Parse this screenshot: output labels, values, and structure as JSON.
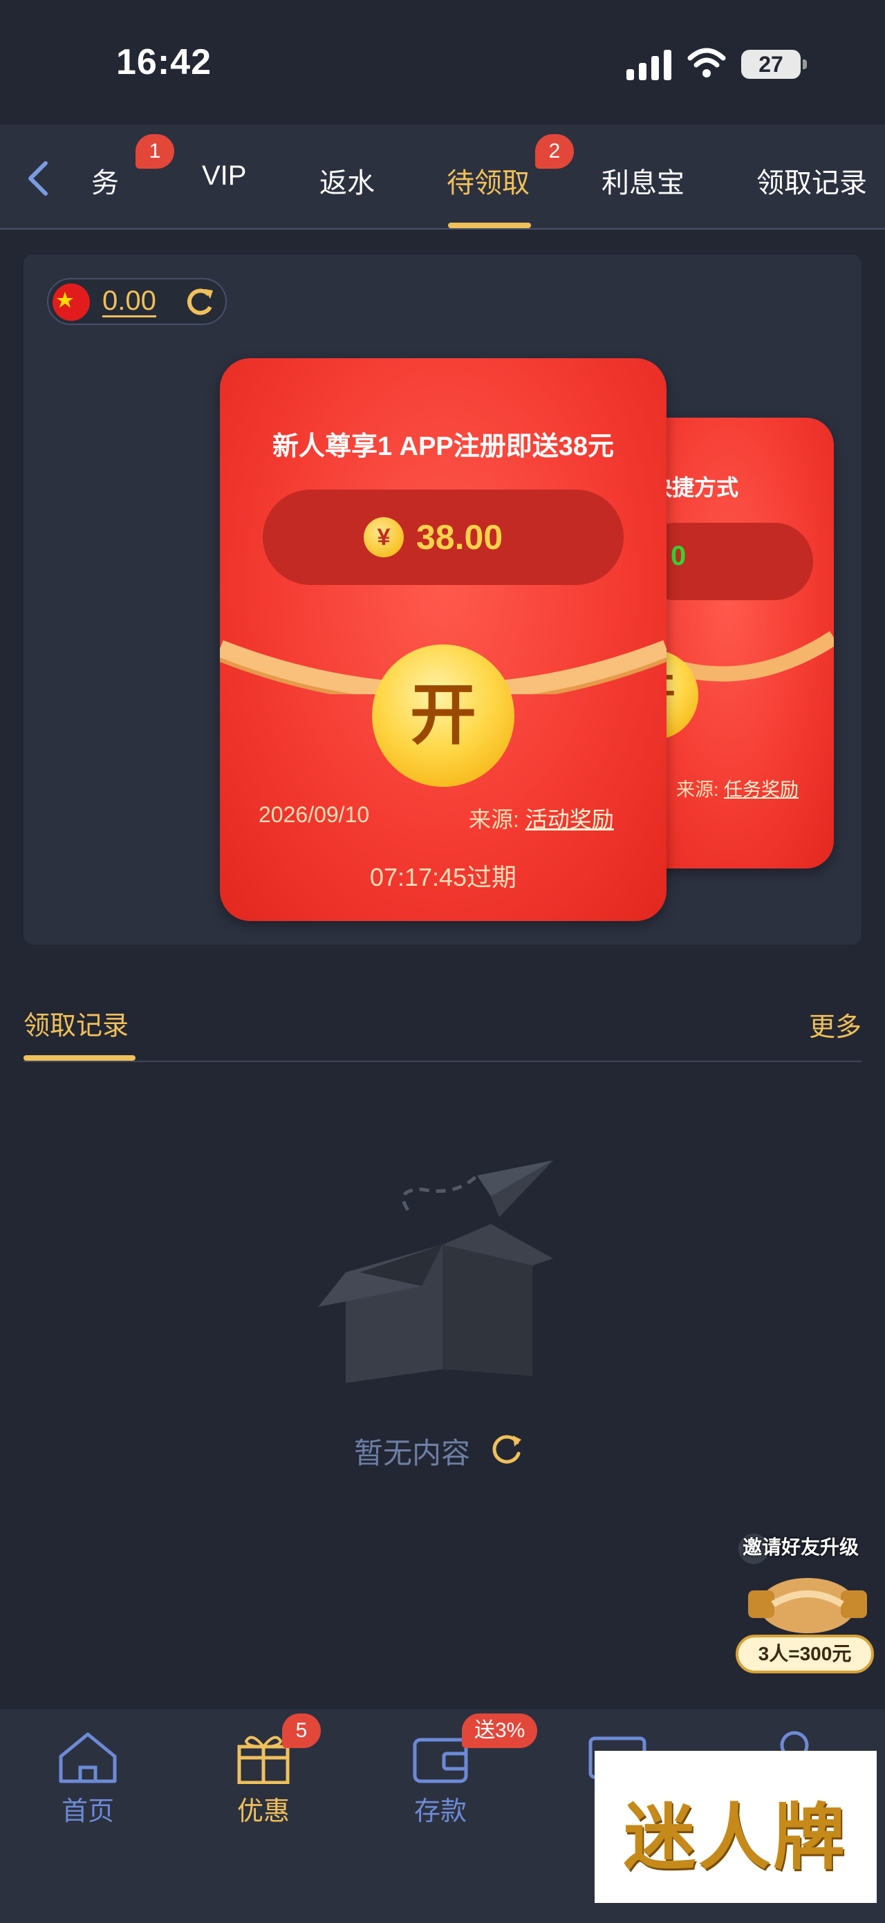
{
  "status_bar": {
    "time": "16:42",
    "battery": "27"
  },
  "tabs": {
    "items": [
      {
        "label": "任务",
        "badge": "1"
      },
      {
        "label": "VIP"
      },
      {
        "label": "返水"
      },
      {
        "label": "待领取",
        "badge": "2",
        "active": true
      },
      {
        "label": "利息宝"
      },
      {
        "label": "领取记录"
      }
    ]
  },
  "wallet": {
    "balance": "0.00",
    "refresh_icon": "refresh-icon",
    "flag_icon": "china-flag-icon"
  },
  "envelopes": [
    {
      "title": "新人尊享1 APP注册即送38元",
      "currency_symbol": "¥",
      "amount": "38.00",
      "open_label": "开",
      "date": "2026/09/10",
      "source_label": "来源:",
      "source_value": "活动奖励",
      "countdown": "07:17:45过期"
    },
    {
      "title_partial": "快捷方式",
      "amount_partial": "0",
      "open_label_partial": "开",
      "source_label": "来源:",
      "source_value": "任务奖励"
    }
  ],
  "records": {
    "title": "领取记录",
    "more": "更多",
    "empty_text": "暂无内容"
  },
  "float_promo": {
    "title": "邀请好友升级",
    "close": "×",
    "offer": "3人=300元"
  },
  "bottom_nav": {
    "items": [
      {
        "label": "首页",
        "icon": "home-icon"
      },
      {
        "label": "优惠",
        "icon": "gift-icon",
        "badge": "5",
        "active": true
      },
      {
        "label": "存款",
        "icon": "wallet-icon",
        "badge": "送3%"
      },
      {
        "label": "",
        "icon": "card-icon"
      },
      {
        "label": "",
        "icon": "user-icon"
      }
    ]
  },
  "watermark": {
    "text": "迷人牌"
  },
  "colors": {
    "accent": "#f0c05a",
    "background": "#232733",
    "panel": "#2c3140",
    "envelope_red": "#f43b32",
    "badge_red": "#e3473a",
    "nav_blue": "#6d8ad6"
  }
}
